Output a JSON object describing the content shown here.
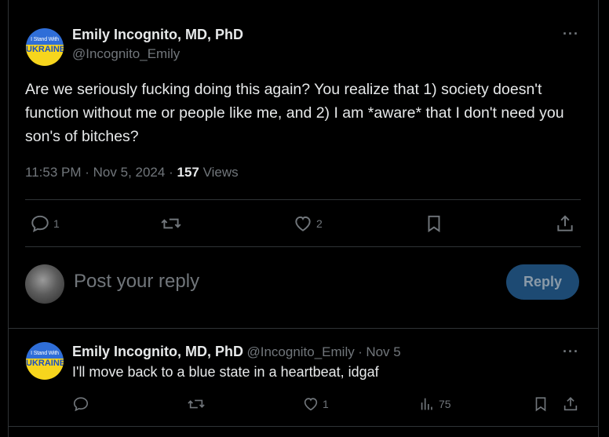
{
  "main_tweet": {
    "author_name": "Emily Incognito, MD, PhD",
    "handle": "@Incognito_Emily",
    "avatar_text_top": "I Stand With",
    "avatar_text_bottom": "UKRAINE",
    "more_label": "···",
    "text": "Are we seriously fucking doing this again? You realize that 1) society doesn't function without me or people like me, and 2) I am *aware* that I don't need you son's of bitches?",
    "time": "11:53 PM",
    "separator": "·",
    "date": "Nov 5, 2024",
    "views_count": "157",
    "views_label": "Views",
    "actions": {
      "reply_count": "1",
      "retweet_count": "",
      "like_count": "2"
    }
  },
  "composer": {
    "placeholder": "Post your reply",
    "button_label": "Reply"
  },
  "reply_tweet": {
    "author_name": "Emily Incognito, MD, PhD",
    "handle": "@Incognito_Emily",
    "separator": "·",
    "date": "Nov 5",
    "avatar_text_top": "I Stand With",
    "avatar_text_bottom": "UKRAINE",
    "more_label": "···",
    "text": "I'll move back to a blue state in a heartbeat, idgaf",
    "actions": {
      "reply_count": "",
      "retweet_count": "",
      "like_count": "1",
      "views_count": "75"
    }
  },
  "colors": {
    "background": "#000000",
    "text_primary": "#e7e9ea",
    "text_secondary": "#71767b",
    "divider": "#2f3336",
    "reply_button_bg": "#1d4a73"
  }
}
